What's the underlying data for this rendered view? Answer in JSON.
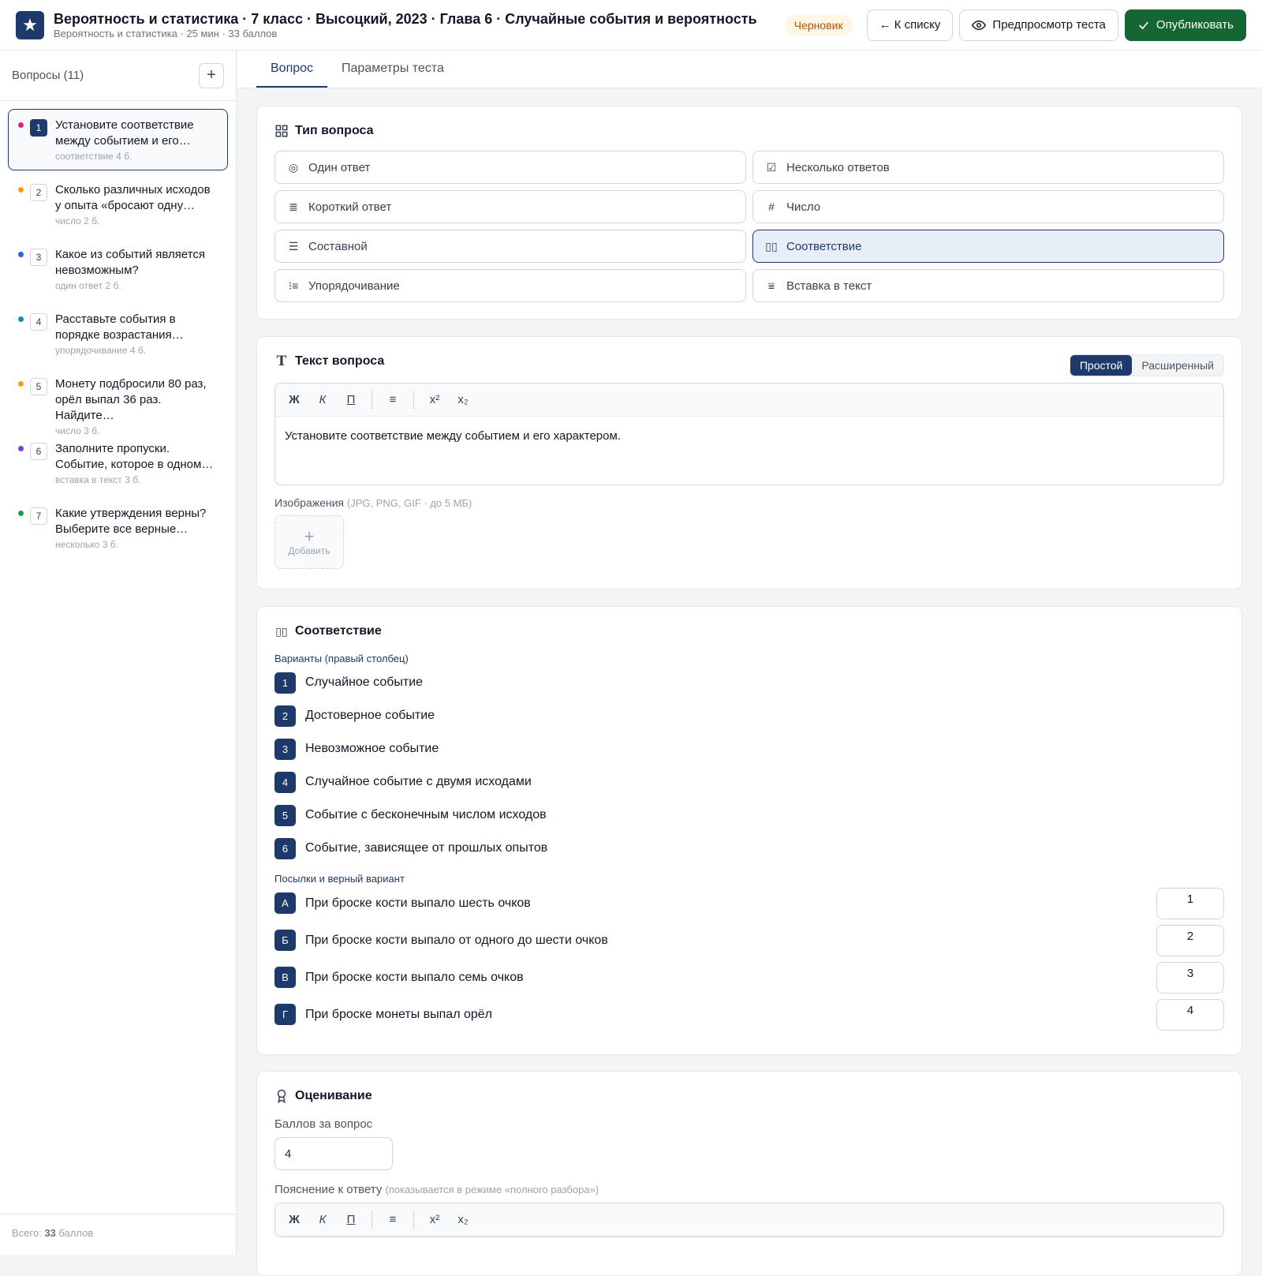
{
  "header": {
    "title": "Вероятность и статистика · 7 класс · Высоцкий, 2023 · Глава 6 · Случайные события и вероятность",
    "subtitle": "Вероятность и статистика · 25 мин · 33 баллов",
    "status_badge": "Черновик",
    "back_label": "← К списку",
    "preview_label": "Предпросмотр теста",
    "publish_label": "Опубликовать"
  },
  "sidebar": {
    "title": "Вопросы (11)",
    "add_label": "+",
    "footer_prefix": "Всего: ",
    "footer_total": "33",
    "footer_suffix": " баллов",
    "items": [
      {
        "num": "1",
        "text": "Установите соответствие между событием и его…",
        "meta": "соответствие  4 б.",
        "color": "#db2777"
      },
      {
        "num": "2",
        "text": "Сколько различных исходов у опыта «бросают одну…",
        "meta": "число  2 б.",
        "color": "#f59e0b"
      },
      {
        "num": "3",
        "text": "Какое из событий является невозможным?",
        "meta": "один ответ  2 б.",
        "color": "#2563eb"
      },
      {
        "num": "4",
        "text": "Расставьте события в порядке возрастания…",
        "meta": "упорядочивание  4 б.",
        "color": "#0891b2"
      },
      {
        "num": "5",
        "text": "Монету подбросили 80 раз, орёл выпал 36 раз. Найдите…",
        "meta": "число  3 б.",
        "color": "#f59e0b"
      },
      {
        "num": "6",
        "text": "Заполните пропуски. Событие, которое в одном…",
        "meta": "вставка в текст  3 б.",
        "color": "#7c3aed"
      },
      {
        "num": "7",
        "text": "Какие утверждения верны? Выберите все верные…",
        "meta": "несколько  3 б.",
        "color": "#16a34a"
      }
    ]
  },
  "tabs": [
    {
      "label": "Вопрос"
    },
    {
      "label": "Параметры теста"
    }
  ],
  "question_type": {
    "title": "Тип вопроса",
    "options": [
      {
        "label": "Один ответ",
        "icon": "radio-icon"
      },
      {
        "label": "Несколько ответов",
        "icon": "checkbox-icon"
      },
      {
        "label": "Короткий ответ",
        "icon": "short-text-icon"
      },
      {
        "label": "Число",
        "icon": "hash-icon"
      },
      {
        "label": "Составной",
        "icon": "list-icon"
      },
      {
        "label": "Соответствие",
        "icon": "columns-icon"
      },
      {
        "label": "Упорядочивание",
        "icon": "ordered-list-icon"
      },
      {
        "label": "Вставка в текст",
        "icon": "insert-text-icon"
      }
    ],
    "selected": "Соответствие"
  },
  "question_text": {
    "title": "Текст вопроса",
    "mode_simple": "Простой",
    "mode_advanced": "Расширенный",
    "toolbar": {
      "bold": "Ж",
      "italic": "К",
      "underline": "П",
      "list": "≡",
      "sup": "x²",
      "sub": "x₂"
    },
    "body": "Установите соответствие между событием и его характером.",
    "images_label": "Изображения",
    "images_hint": "(JPG, PNG, GIF · до 5 МБ)",
    "add_image": "Добавить"
  },
  "matching": {
    "title": "Соответствие",
    "options_label": "Варианты (правый столбец)",
    "options": [
      {
        "num": "1",
        "text": "Случайное событие"
      },
      {
        "num": "2",
        "text": "Достоверное событие"
      },
      {
        "num": "3",
        "text": "Невозможное событие"
      },
      {
        "num": "4",
        "text": "Случайное событие с двумя исходами"
      },
      {
        "num": "5",
        "text": "Событие с бесконечным числом исходов"
      },
      {
        "num": "6",
        "text": "Событие, зависящее от прошлых опытов"
      }
    ],
    "premises_label": "Посылки и верный вариант",
    "premises": [
      {
        "letter": "А",
        "text": "При броске кости выпало шесть очков",
        "answer": "1"
      },
      {
        "letter": "Б",
        "text": "При броске кости выпало от одного до шести очков",
        "answer": "2"
      },
      {
        "letter": "В",
        "text": "При броске кости выпало семь очков",
        "answer": "3"
      },
      {
        "letter": "Г",
        "text": "При броске монеты выпал орёл",
        "answer": "4"
      }
    ]
  },
  "grading": {
    "title": "Оценивание",
    "points_label": "Баллов за вопрос",
    "points_value": "4",
    "explanation_label": "Пояснение к ответу",
    "explanation_hint": "(показывается в режиме «полного разбора»)"
  }
}
